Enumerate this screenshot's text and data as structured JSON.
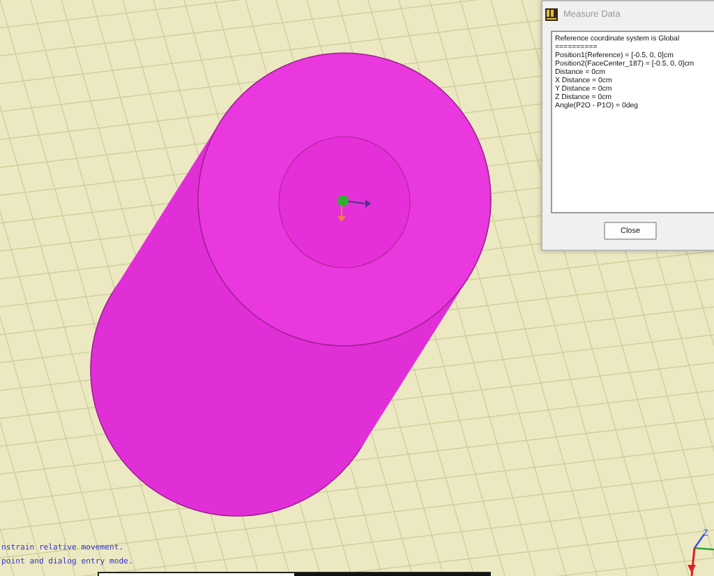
{
  "dialog": {
    "title": "Measure Data",
    "active": false,
    "lines": [
      "Reference coordinate system is Global",
      "==========",
      "Position1(Reference) = [-0.5, 0, 0]cm",
      "Position2(FaceCenter_187) = [-0.5, 0, 0]cm",
      "Distance = 0cm",
      "X Distance = 0cm",
      "Y Distance = 0cm",
      "Z Distance = 0cm",
      "Angle(P2O - P1O) = 0deg"
    ],
    "buttons": [
      "Close"
    ]
  },
  "axis_triad": {
    "label": "Z"
  },
  "messages": [
    "nstrain relative movement.",
    "point and dialog entry mode."
  ],
  "progress": {
    "level": 0.5
  }
}
